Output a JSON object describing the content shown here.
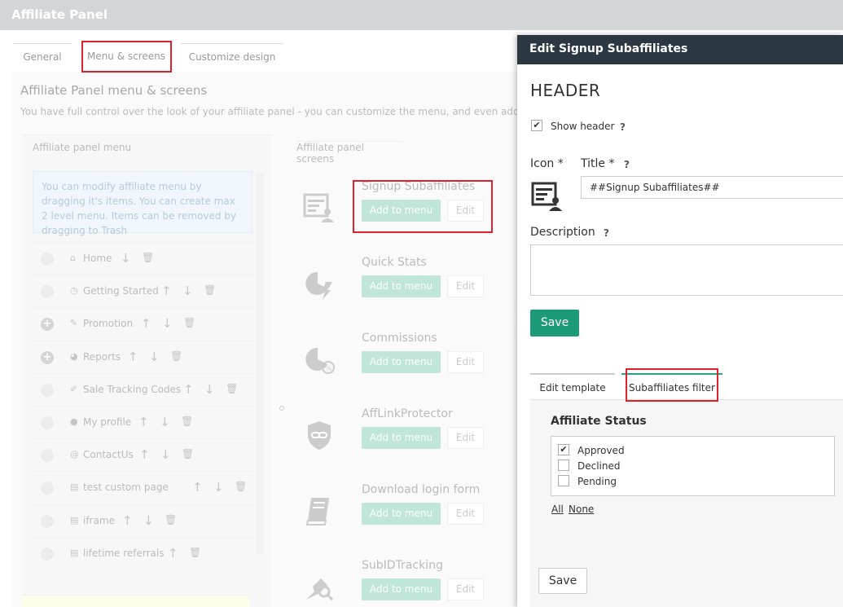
{
  "app": {
    "title": "Affiliate Panel"
  },
  "tabs": [
    {
      "label": "General"
    },
    {
      "label": "Menu & screens"
    },
    {
      "label": "Customize design"
    }
  ],
  "page": {
    "heading": "Affiliate Panel menu & screens",
    "subtitle": "You have full control over the look of your affiliate panel - you can customize the menu, and even add your st"
  },
  "menu": {
    "column_title": "Affiliate panel menu",
    "hint": "You can modify affiliate menu by dragging it's items. You can create max 2 level menu. Items can be removed by dragging to Trash",
    "items": [
      {
        "label": "Home",
        "icon": "home-icon"
      },
      {
        "label": "Getting Started",
        "icon": "clock-icon"
      },
      {
        "label": "Promotion",
        "icon": "megaphone-icon"
      },
      {
        "label": "Reports",
        "icon": "pie-chart-icon"
      },
      {
        "label": "Sale Tracking Codes",
        "icon": "tracking-icon"
      },
      {
        "label": "My profile",
        "icon": "user-icon"
      },
      {
        "label": "ContactUs",
        "icon": "at-icon"
      },
      {
        "label": "test custom page",
        "icon": "page-icon"
      },
      {
        "label": "iframe",
        "icon": "page-icon"
      },
      {
        "label": "lifetime referrals",
        "icon": "page-icon"
      }
    ]
  },
  "screens": {
    "column_title": "Affiliate panel screens",
    "add_label": "Add to menu",
    "edit_label": "Edit",
    "items": [
      {
        "name": "Signup Subaffiliates",
        "icon": "signup-subaffiliates-icon"
      },
      {
        "name": "Quick Stats",
        "icon": "quick-stats-icon"
      },
      {
        "name": "Commissions",
        "icon": "commissions-icon"
      },
      {
        "name": "AffLinkProtector",
        "icon": "link-protector-icon"
      },
      {
        "name": "Download login form",
        "icon": "book-icon"
      },
      {
        "name": "SubIDTracking",
        "icon": "subid-tracking-icon"
      }
    ]
  },
  "dialog": {
    "title": "Edit Signup Subaffiliates",
    "section": "HEADER",
    "show_header_label": "Show header",
    "show_header_checked": true,
    "icon_label": "Icon *",
    "title_label": "Title *",
    "title_value": "##Signup Subaffiliates##",
    "description_label": "Description",
    "help": "?",
    "save_label": "Save",
    "subtabs": [
      {
        "label": "Edit template"
      },
      {
        "label": "Subaffiliates filter"
      }
    ],
    "filter": {
      "heading": "Affiliate Status",
      "options": [
        {
          "label": "Approved",
          "checked": true
        },
        {
          "label": "Declined",
          "checked": false
        },
        {
          "label": "Pending",
          "checked": false
        }
      ],
      "all_label": "All",
      "none_label": "None",
      "save_label": "Save"
    }
  }
}
